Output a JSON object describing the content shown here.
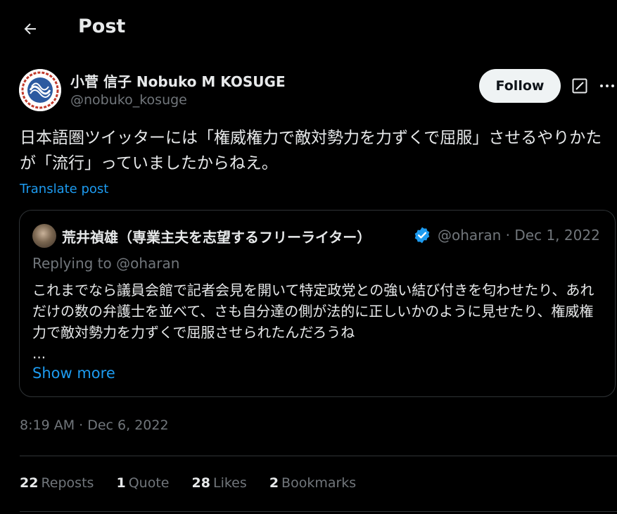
{
  "header": {
    "title": "Post"
  },
  "author": {
    "name": "小菅 信子 Nobuko M KOSUGE",
    "handle": "@nobuko_kosuge",
    "follow_label": "Follow"
  },
  "post": {
    "text": "日本語圏ツイッターには「権威権力で敵対勢力を力ずくで屈服」させるやりかたが「流行」っていましたからねえ。",
    "translate_label": "Translate post",
    "timestamp": "8:19 AM · Dec 6, 2022"
  },
  "quote": {
    "name": "荒井禎雄（専業主夫を志望するフリーライター）",
    "handle_date": "@oharan · Dec 1, 2022",
    "replying": "Replying to @oharan",
    "text": "これまでなら議員会館で記者会見を開いて特定政党との強い結び付きを匂わせたり、あれだけの数の弁護士を並べて、さも自分達の側が法的に正しいかのように見せたり、権威権力で敵対勢力を力ずくで屈服させられたんだろうね",
    "ellipsis": "...",
    "show_more": "Show more"
  },
  "stats": [
    {
      "count": "22",
      "label": "Reposts"
    },
    {
      "count": "1",
      "label": "Quote"
    },
    {
      "count": "28",
      "label": "Likes"
    },
    {
      "count": "2",
      "label": "Bookmarks"
    }
  ],
  "colors": {
    "accent": "#1d9bf0",
    "muted": "#71767b",
    "text": "#e7e9ea",
    "border": "#2f3336"
  },
  "icons": [
    "back-arrow-icon",
    "grok-icon",
    "more-icon",
    "verified-badge-icon"
  ]
}
